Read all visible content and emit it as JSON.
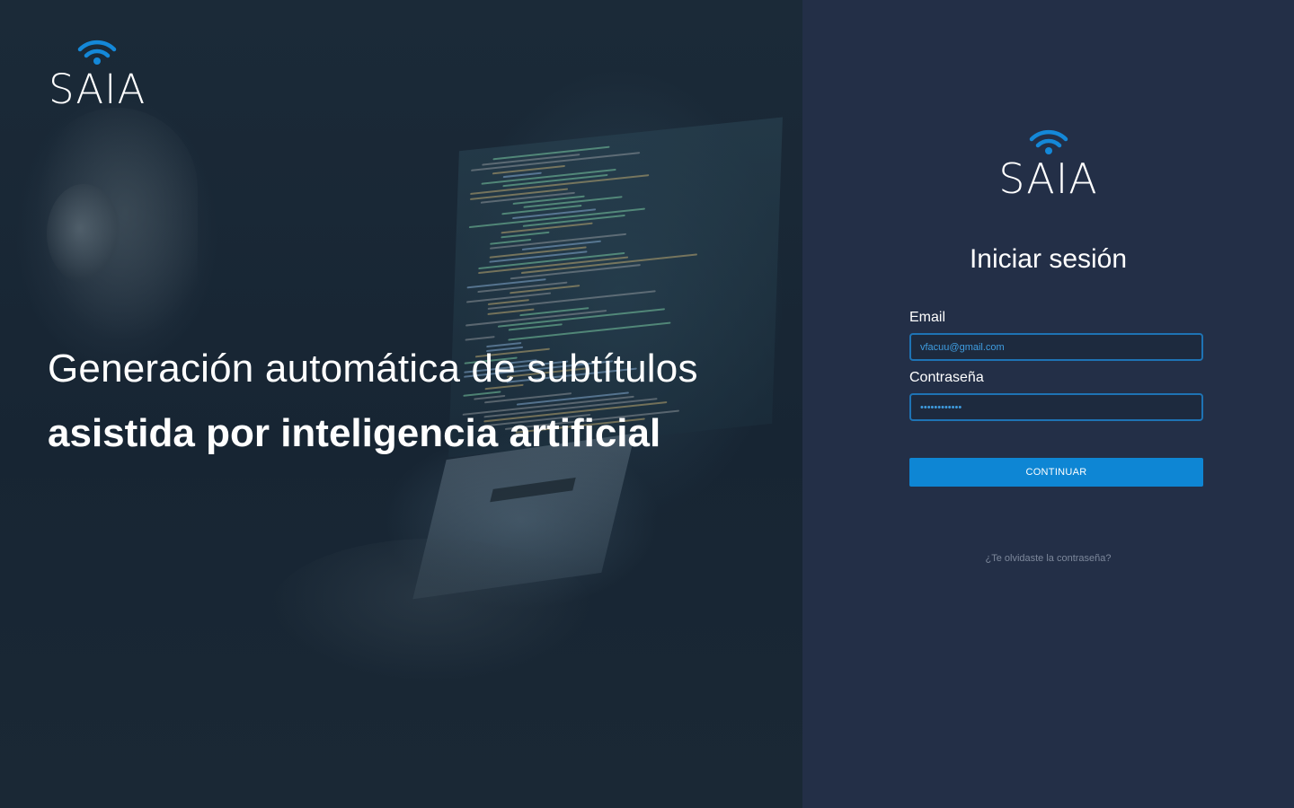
{
  "brand": {
    "name": "SAIA",
    "accent_color": "#0e86d4",
    "logo_icon": "wifi-signal-icon"
  },
  "hero": {
    "headline_regular": "Generación automática de subtítulos",
    "headline_bold": "asistida por inteligencia artificial"
  },
  "login": {
    "title": "Iniciar sesión",
    "email": {
      "label": "Email",
      "value": "vfacuu@gmail.com"
    },
    "password": {
      "label": "Contraseña",
      "value": "••••••••••••"
    },
    "continue_label": "CONTINUAR",
    "forgot_label": "¿Te olvidaste la contraseña?"
  }
}
